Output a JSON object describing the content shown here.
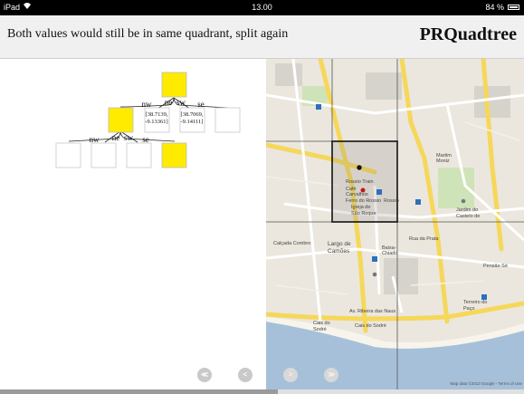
{
  "status_bar": {
    "carrier": "iPad",
    "wifi_icon": "wifi-icon",
    "time": "13.00",
    "battery": "84 %",
    "battery_icon": "battery-icon"
  },
  "header": {
    "step_text": "Both values would still be in same quadrant, split again",
    "app_title": "PRQuadtree"
  },
  "tree": {
    "edge_labels": [
      "nw",
      "ne",
      "sw",
      "se"
    ],
    "level2_edge_labels": [
      "nw",
      "ne",
      "sw",
      "se"
    ],
    "node_values": [
      {
        "line1": "[38.7139,",
        "line2": "-9.13361]"
      },
      {
        "line1": "[38.7069,",
        "line2": "-9.14111]"
      }
    ],
    "highlight_color": "#ffeb00"
  },
  "map": {
    "labels": {
      "rossio_train": "Rossio Train",
      "cafe": "Café",
      "carvalhos": "Carvalhos",
      "ferro": "Ferro do Rossio",
      "rossio": "Rossio",
      "igreja": "Igreja de",
      "sao_roque": "São Roque",
      "jardim": "Jardim do",
      "castelo": "Castelo de",
      "calcada_combro": "Calçada Combro",
      "largo": "Largo de",
      "camoes": "Camões",
      "baixa": "Baixa-",
      "chiado": "Chiado",
      "av_ribeira": "Av. Ribeira das Naus",
      "cais_sodre": "Cais do",
      "sodre": "Sodré",
      "cais_sodre_2": "Cais do Sodré",
      "rua_prata": "Rua da Prata",
      "martim": "Martim",
      "moniz": "Moniz",
      "pensao": "Pensão Sé",
      "terreiro": "Terreiro do",
      "paco": "Paço"
    },
    "attribution": "Map data ©2013 Google - Terms of Use"
  },
  "nav": {
    "first": "≪",
    "prev": "<",
    "next": ">",
    "last": "≫"
  },
  "scroll": {
    "progress": 0.53
  }
}
